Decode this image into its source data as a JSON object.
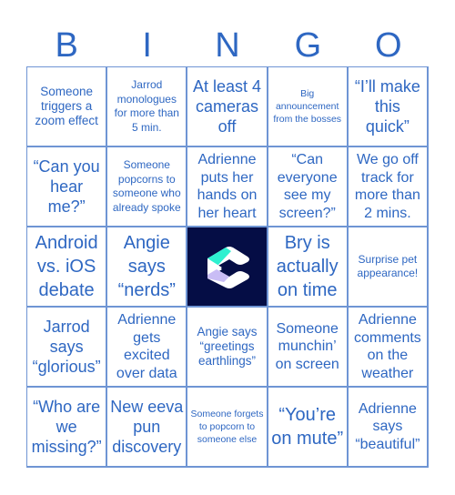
{
  "header": {
    "letters": [
      "B",
      "I",
      "N",
      "G",
      "O"
    ]
  },
  "colors": {
    "text": "#2e67c2",
    "grid_line": "#6f95d4",
    "free_bg": "#050d45",
    "logo_white": "#ffffff",
    "logo_teal": "#2ef0d0",
    "logo_lavender": "#c9bdf5"
  },
  "cells": [
    [
      "Someone triggers a zoom effect",
      "Jarrod monologues for more than 5 min.",
      "At least 4 cameras off",
      "Big announcement from the bosses",
      "“I’ll make this quick”"
    ],
    [
      "“Can you hear me?”",
      "Someone popcorns to someone who already spoke",
      "Adrienne puts her hands on her heart",
      "“Can everyone see my screen?”",
      "We go off track for more than 2 mins."
    ],
    [
      "Android vs. iOS debate",
      "Angie says “nerds”",
      "",
      "Bry is actually on time",
      "Surprise pet appearance!"
    ],
    [
      "Jarrod says “glorious”",
      "Adrienne gets excited over data",
      "Angie says “greetings earthlings”",
      "Someone munchin’ on screen",
      "Adrienne comments on the weather"
    ],
    [
      "“Who are we missing?”",
      "New eeva pun discovery",
      "Someone forgets to popcorn to someone else",
      "“You’re on mute”",
      "Adrienne says “beautiful”"
    ]
  ],
  "free_space": {
    "icon": "eeva-logo-icon"
  }
}
